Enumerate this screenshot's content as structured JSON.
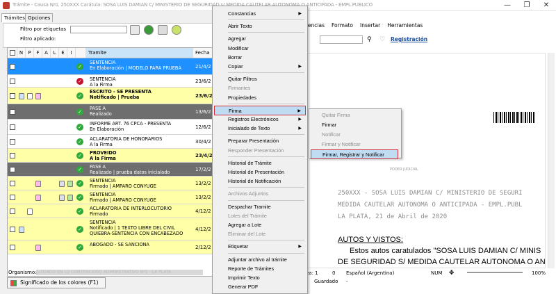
{
  "window": {
    "title": "Trámite - Causa Nro. 250XXX Carátula: SOSA LUIS DAMIAN C/ MINISTERIO DE SEGURIDAD s/ MEDIDA CAUTELAR AUTONOMA O ANTICIPADA - EMPL.PUBLICO",
    "min": "—",
    "max": "❐",
    "close": "✕"
  },
  "left": {
    "tabs": [
      "Trámites",
      "Opciones"
    ],
    "filter_label": "Filtro por etiquetas",
    "filter_applied_label": "Filtro aplicado:",
    "columns": [
      "N",
      "P",
      "F",
      "A",
      "L",
      "E",
      "I",
      "Tramite",
      "Fecha"
    ],
    "rows": [
      {
        "l1": "SENTENCIA",
        "l2": "En Elaboración | MODELO PARA PRUEBA",
        "fecha": "21/4/2",
        "style": "selected",
        "dot": "green"
      },
      {
        "l1": "SENTENCIA",
        "l2": "A la Firma",
        "fecha": "23/6/2",
        "style": "white",
        "dot": "red"
      },
      {
        "l1": "ESCRITO - SE PRESENTA",
        "l2": "Notificado | Prueba",
        "fecha": "23/6/2",
        "style": "yellow",
        "dot": "green"
      },
      {
        "l1": "PASE A",
        "l2": "Realizado",
        "fecha": "13/6/2",
        "style": "gray",
        "dot": "green"
      },
      {
        "l1": "INFORME ART. 76 CPCA - PRESENTA",
        "l2": "En Elaboración",
        "fecha": "12/6/2",
        "style": "white",
        "dot": "green"
      },
      {
        "l1": "ACLARATORIA DE HONORARIOS",
        "l2": "A la Firma",
        "fecha": "30/4/2",
        "style": "white",
        "dot": "green"
      },
      {
        "l1": "PROVEIDO",
        "l2": "A la Firma",
        "fecha": "23/4/2",
        "style": "yellow",
        "dot": "green"
      },
      {
        "l1": "PASE A",
        "l2": "Realizado | prueba datos inicialado",
        "fecha": "17/2/2",
        "style": "gray",
        "dot": "green"
      },
      {
        "l1": "SENTENCIA",
        "l2": "Firmado | AMPARO CONYUGE",
        "fecha": "13/2/2",
        "style": "yellow",
        "dot": "green"
      },
      {
        "l1": "SENTENCIA",
        "l2": "Firmado | AMPARO CONYUGE",
        "fecha": "13/2/2",
        "style": "yellow",
        "dot": "green"
      },
      {
        "l1": "ACLARATORIA DE INTERLOCUTORIO",
        "l2": "Firmado",
        "fecha": "4/12/2",
        "style": "yellow",
        "dot": "green"
      },
      {
        "l1": "SENTENCIA",
        "l2": "Notificado | 1 TEXTO LIBRE DEL CIVIL QUIEBRA-SENTENCIA CON ENCABEZADO",
        "fecha": "4/12/2",
        "style": "yellow3",
        "dot": "green"
      },
      {
        "l1": "ABOGADO - SE SANCIONA",
        "l2": "",
        "fecha": "2/12/2",
        "style": "yellow",
        "dot": "green"
      }
    ],
    "organismo_label": "Organismo:",
    "organismo_value": "JUZGADO EN LO CONTENCIOSO ADMINISTRATIVO Nº1 - LA PLATA",
    "colors_button": "Significado de los colores (F1)"
  },
  "right": {
    "menu": [
      "rencias",
      "Formato",
      "Insertar",
      "Herramientas"
    ],
    "registro_link": "Registración",
    "doc_header": "PODER JUDICIAL",
    "doc_lines": [
      "250XXX - SOSA LUIS DAMIAN C/ MINISTERIO DE SEGURI",
      "MEDIDA CAUTELAR AUTONOMA O ANTICIPADA - EMPL.PUBL",
      "LA PLATA, 21 de Abril de 2020"
    ],
    "autos": "AUTOS Y VISTOS:",
    "body1": "Estos autos caratulados \"SOSA LUIS DAMIAN C/ MINIS",
    "body2": "DE SEGURIDAD S/ MEDIDA CAUTELAR AUTONOMA O ANTICI",
    "status": {
      "linea": "ea: 1",
      "col": "0",
      "lang": "Español (Argentina)",
      "num": "NUM",
      "zoom": "100%",
      "guardado": "Guardado",
      "dash": "-"
    }
  },
  "context_menu": {
    "items": [
      {
        "label": "Constancias",
        "sub": true,
        "disabled": false
      },
      {
        "sep": true
      },
      {
        "label": "Abrir Texto",
        "disabled": false
      },
      {
        "sep": true
      },
      {
        "label": "Agregar",
        "disabled": false
      },
      {
        "label": "Modificar",
        "disabled": false
      },
      {
        "label": "Borrar",
        "disabled": false
      },
      {
        "label": "Copiar",
        "sub": true,
        "disabled": false
      },
      {
        "sep": true
      },
      {
        "label": "Quitar Filtros",
        "disabled": false
      },
      {
        "label": "Firmantes",
        "disabled": true
      },
      {
        "label": "Propiedades",
        "disabled": false
      },
      {
        "sep": true
      },
      {
        "label": "Firma",
        "sub": true,
        "disabled": false,
        "highlight": true
      },
      {
        "label": "Registros Electrónicos",
        "sub": true,
        "disabled": false
      },
      {
        "label": "Inicialado de Texto",
        "sub": true,
        "disabled": false
      },
      {
        "sep": true
      },
      {
        "label": "Preparar Presentación",
        "disabled": false
      },
      {
        "label": "Responder Presentación",
        "disabled": true
      },
      {
        "sep": true
      },
      {
        "label": "Historial de Trámite",
        "disabled": false
      },
      {
        "label": "Historial de Presentación",
        "disabled": false
      },
      {
        "label": "Historial de Notificación",
        "disabled": false
      },
      {
        "sep": true
      },
      {
        "label": "Archivos Adjuntos",
        "disabled": true
      },
      {
        "sep": true
      },
      {
        "label": "Despachar Tramite",
        "disabled": false
      },
      {
        "label": "Lotes del Trámite",
        "disabled": true
      },
      {
        "label": "Agregar a Lote",
        "disabled": false
      },
      {
        "label": "Eliminar del Lote",
        "disabled": true
      },
      {
        "sep": true
      },
      {
        "label": "Etiquetar",
        "sub": true,
        "disabled": false
      },
      {
        "sep": true
      },
      {
        "label": "Adjuntar archivo al trámite",
        "disabled": false
      },
      {
        "label": "Reporte de Trámites",
        "disabled": false
      },
      {
        "label": "Imprimir Texto",
        "disabled": false
      },
      {
        "label": "Generar PDF",
        "disabled": false
      }
    ]
  },
  "submenu": {
    "items": [
      {
        "label": "Quitar Firma",
        "disabled": true
      },
      {
        "label": "Firmar",
        "disabled": false
      },
      {
        "label": "Notificar",
        "disabled": true
      },
      {
        "label": "Firmar y Notificar",
        "disabled": true
      },
      {
        "label": "Firmar, Registrar y Notificar",
        "disabled": false,
        "highlight": true
      }
    ]
  },
  "colors": {
    "selected": "#1e90ff",
    "yellow": "#ffffa8",
    "gray": "#6e6e6e",
    "highlight": "#c0dcf3",
    "red_border": "#d12f3c"
  }
}
